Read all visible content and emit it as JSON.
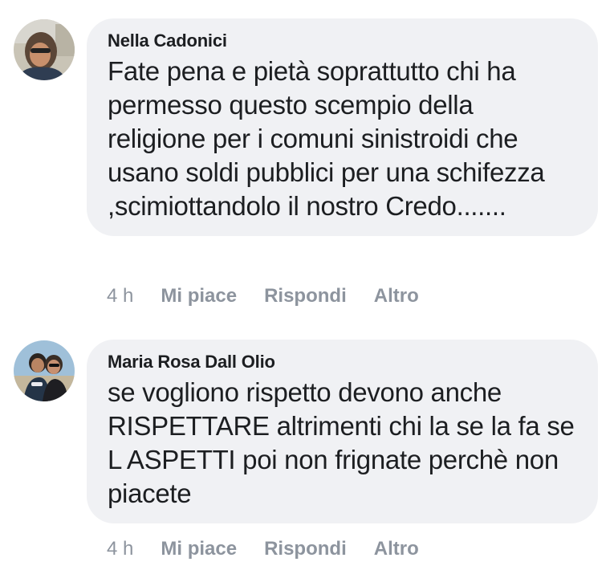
{
  "comments": [
    {
      "author": "Nella Cadonici",
      "avatar_icon": "user-avatar-photo",
      "text": "Fate pena e pietà soprattutto chi ha permesso questo scempio della religione per i comuni sinistroidi che usano soldi pubblici per una schifezza ,scimiottandolo il nostro Credo.......",
      "time": "4 h",
      "like_label": "Mi piace",
      "reply_label": "Rispondi",
      "more_label": "Altro"
    },
    {
      "author": "Maria Rosa Dall Olio",
      "avatar_icon": "user-avatar-photo",
      "text": "se vogliono rispetto devono anche RISPETTARE altrimenti chi la se la fa se L ASPETTI poi non frignate perchè non piacete",
      "time": "4 h",
      "like_label": "Mi piace",
      "reply_label": "Rispondi",
      "more_label": "Altro"
    }
  ],
  "colors": {
    "bubble_bg": "#f0f1f4",
    "text": "#1c1e21",
    "meta": "#8d949e"
  }
}
